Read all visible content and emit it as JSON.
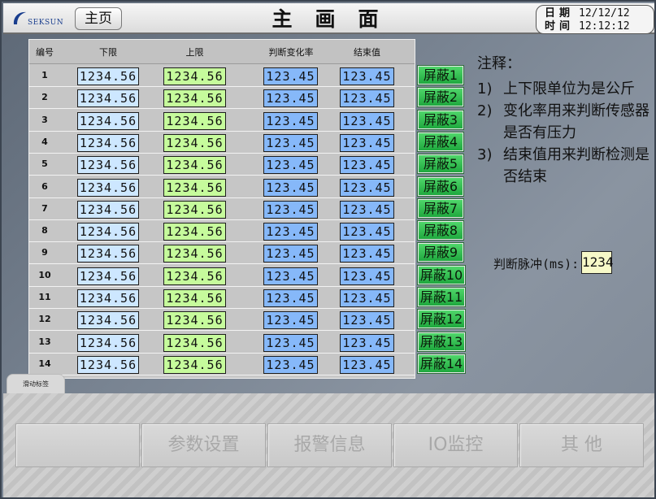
{
  "header": {
    "logo_text": "SEKSUN",
    "home_label": "主页",
    "title": "主画面",
    "date_label": "日期",
    "date_value": "12/12/12",
    "time_label": "时间",
    "time_value": "12:12:12"
  },
  "table": {
    "headers": {
      "index": "编号",
      "lower": "下限",
      "upper": "上限",
      "rate": "判断变化率",
      "end": "结束值"
    },
    "rows": [
      {
        "no": "1",
        "lower": "1234.56",
        "upper": "1234.56",
        "rate": "123.45",
        "end": "123.45",
        "shield": "屏蔽1"
      },
      {
        "no": "2",
        "lower": "1234.56",
        "upper": "1234.56",
        "rate": "123.45",
        "end": "123.45",
        "shield": "屏蔽2"
      },
      {
        "no": "3",
        "lower": "1234.56",
        "upper": "1234.56",
        "rate": "123.45",
        "end": "123.45",
        "shield": "屏蔽3"
      },
      {
        "no": "4",
        "lower": "1234.56",
        "upper": "1234.56",
        "rate": "123.45",
        "end": "123.45",
        "shield": "屏蔽4"
      },
      {
        "no": "5",
        "lower": "1234.56",
        "upper": "1234.56",
        "rate": "123.45",
        "end": "123.45",
        "shield": "屏蔽5"
      },
      {
        "no": "6",
        "lower": "1234.56",
        "upper": "1234.56",
        "rate": "123.45",
        "end": "123.45",
        "shield": "屏蔽6"
      },
      {
        "no": "7",
        "lower": "1234.56",
        "upper": "1234.56",
        "rate": "123.45",
        "end": "123.45",
        "shield": "屏蔽7"
      },
      {
        "no": "8",
        "lower": "1234.56",
        "upper": "1234.56",
        "rate": "123.45",
        "end": "123.45",
        "shield": "屏蔽8"
      },
      {
        "no": "9",
        "lower": "1234.56",
        "upper": "1234.56",
        "rate": "123.45",
        "end": "123.45",
        "shield": "屏蔽9"
      },
      {
        "no": "10",
        "lower": "1234.56",
        "upper": "1234.56",
        "rate": "123.45",
        "end": "123.45",
        "shield": "屏蔽10"
      },
      {
        "no": "11",
        "lower": "1234.56",
        "upper": "1234.56",
        "rate": "123.45",
        "end": "123.45",
        "shield": "屏蔽11"
      },
      {
        "no": "12",
        "lower": "1234.56",
        "upper": "1234.56",
        "rate": "123.45",
        "end": "123.45",
        "shield": "屏蔽12"
      },
      {
        "no": "13",
        "lower": "1234.56",
        "upper": "1234.56",
        "rate": "123.45",
        "end": "123.45",
        "shield": "屏蔽13"
      },
      {
        "no": "14",
        "lower": "1234.56",
        "upper": "1234.56",
        "rate": "123.45",
        "end": "123.45",
        "shield": "屏蔽14"
      }
    ]
  },
  "notes": {
    "title": "注释：",
    "items": [
      {
        "num": "1)",
        "text": "上下限单位为是公斤"
      },
      {
        "num": "2)",
        "text": "变化率用来判断传感器是否有压力"
      },
      {
        "num": "3)",
        "text": "结束值用来判断检测是否结束"
      }
    ]
  },
  "pulse": {
    "label": "判断脉冲(ms):",
    "value": "1234"
  },
  "scroll_tab_label": "滑动标签",
  "nav": {
    "buttons": [
      "",
      "参数设置",
      "报警信息",
      "IO监控",
      "其 他"
    ]
  },
  "colors": {
    "lower_field": "#cde7ff",
    "upper_field": "#c6fb9c",
    "rate_field": "#86b8f9",
    "shield_button": "#2fbd4f",
    "pulse_field": "#f7f9c8"
  }
}
